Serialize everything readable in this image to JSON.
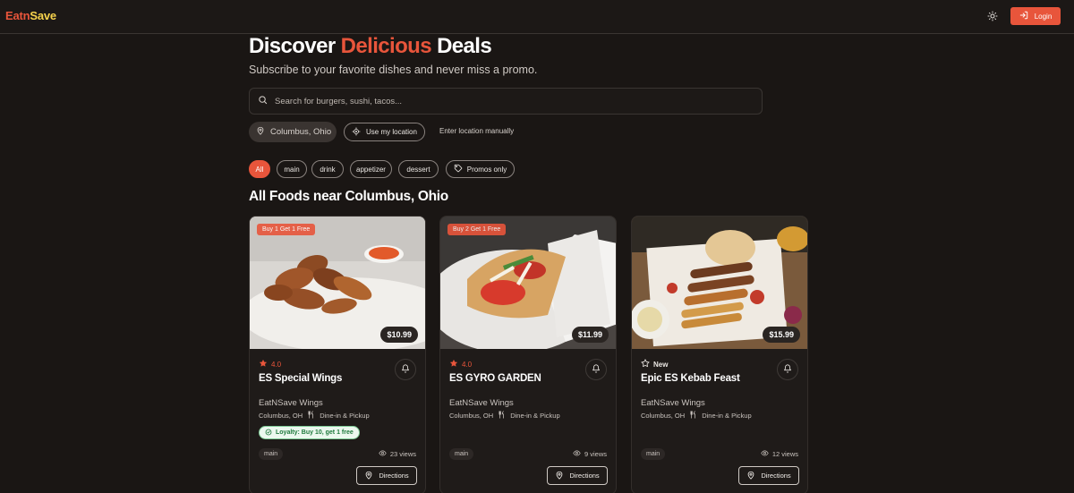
{
  "header": {
    "logo_part1": "Eatn",
    "logo_part2": "Save",
    "login_label": "Login"
  },
  "hero": {
    "title_part1": "Discover",
    "title_accent": "Delicious",
    "title_part2": "Deals",
    "subtitle": "Subscribe to your favorite dishes and never miss a promo."
  },
  "search": {
    "placeholder": "Search for burgers, sushi, tacos..."
  },
  "location": {
    "current": "Columbus, Ohio",
    "use_my_location_label": "Use my location",
    "manual_label": "Enter location manually"
  },
  "filters": {
    "chips": [
      "All",
      "main",
      "drink",
      "appetizer",
      "dessert"
    ],
    "active": "All",
    "promos_only_label": "Promos only"
  },
  "section_title": "All Foods near Columbus, Ohio",
  "cards": [
    {
      "promo": "Buy 1 Get 1 Free",
      "price": "$10.99",
      "rating": "4.0",
      "title": "ES Special Wings",
      "restaurant": "EatNSave Wings",
      "city": "Columbus, OH",
      "service": "Dine-in & Pickup",
      "loyalty": "Loyalty: Buy 10, get 1 free",
      "tag": "main",
      "views": "23 views",
      "directions_label": "Directions"
    },
    {
      "promo": "Buy 2 Get 1 Free",
      "price": "$11.99",
      "rating": "4.0",
      "title": "ES GYRO GARDEN",
      "restaurant": "EatNSave Wings",
      "city": "Columbus, OH",
      "service": "Dine-in & Pickup",
      "tag": "main",
      "views": "9 views",
      "directions_label": "Directions"
    },
    {
      "price": "$15.99",
      "rating": "New",
      "title": "Epic ES Kebab Feast",
      "restaurant": "EatNSave Wings",
      "city": "Columbus, OH",
      "service": "Dine-in & Pickup",
      "tag": "main",
      "views": "12 views",
      "directions_label": "Directions"
    }
  ],
  "colors": {
    "accent": "#e8553b",
    "logo_secondary": "#f7d34c",
    "background": "#1a1614"
  }
}
